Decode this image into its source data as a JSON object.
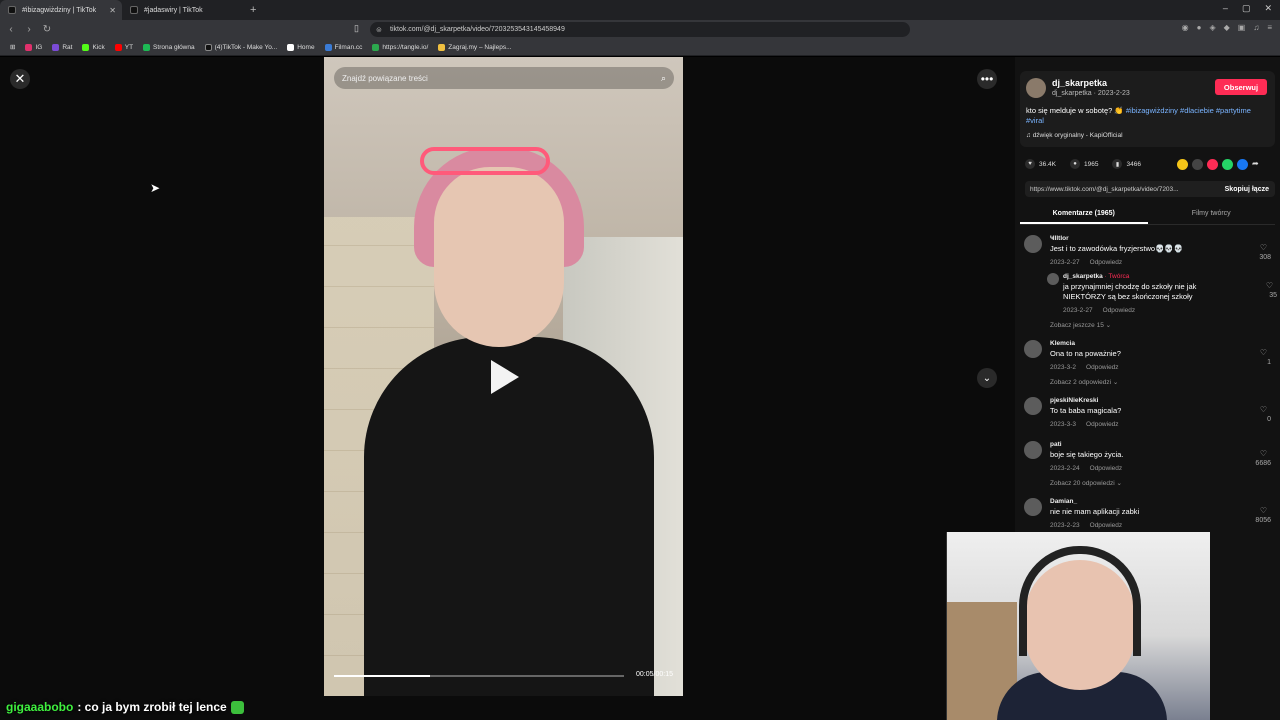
{
  "browser": {
    "tabs": [
      {
        "title": "#ibizagwiżdziny | TikTok",
        "active": true
      },
      {
        "title": "#jadaswiry | TikTok",
        "active": false
      }
    ],
    "url": "tiktok.com/@dj_skarpetka/video/7203253543145458949",
    "bookmarks": [
      "IG",
      "Rat",
      "Kick",
      "YT",
      "Strona główna",
      "(4)TikTok - Make Yo...",
      "Home",
      "Filman.cc",
      "https://tangle.io/",
      "Zagraj.my – Najleps..."
    ]
  },
  "video": {
    "search_placeholder": "Znajdź powiązane treści",
    "time": "00:05/00:15",
    "progress": 0.33
  },
  "post": {
    "username": "dj_skarpetka",
    "sub": "dj_skarpetka · 2023-2-23",
    "follow_label": "Obserwuj",
    "caption_text": "kto się melduje w sobotę? 👏",
    "caption_tags": "#ibizagwiżdziny #dlaciebie #partytime #viral",
    "sound": "dźwięk oryginalny - KapiOfficial",
    "likes": "36.4K",
    "comments": "1965",
    "saves": "3466",
    "link": "https://www.tiktok.com/@dj_skarpetka/video/7203...",
    "copy_label": "Skopiuj łącze",
    "tab_comments": "Komentarze (1965)",
    "tab_creator": "Filmy twórcy"
  },
  "comments": [
    {
      "name": "Ҹlltlor",
      "text": "Jest i to zawodówka fryzjerstwo💀💀💀",
      "date": "2023-2-27",
      "reply": "Odpowiedz",
      "likes": "308"
    },
    {
      "name": "dj_skarpetka",
      "creator_tag": "· Twórca",
      "text": "ja przynajmniej chodzę do szkoły nie jak NIEKTÓRZY są bez skończonej szkoły",
      "date": "2023-2-27",
      "reply": "Odpowiedz",
      "likes": "35",
      "more": "Zobacz jeszcze 15 ⌄"
    },
    {
      "name": "Klemcia",
      "text": "Ona to na poważnie?",
      "date": "2023-3-2",
      "reply": "Odpowiedz",
      "likes": "1",
      "more": "Zobacz 2 odpowiedzi ⌄"
    },
    {
      "name": "pjeskiNieKreski",
      "text": "To ta baba magicala?",
      "date": "2023-3-3",
      "reply": "Odpowiedz",
      "likes": "0"
    },
    {
      "name": "pati",
      "text": "boje się takiego życia.",
      "date": "2023-2-24",
      "reply": "Odpowiedz",
      "likes": "6686",
      "more": "Zobacz 20 odpowiedzi ⌄"
    },
    {
      "name": "Damian_",
      "text": "nie nie mam aplikacji zabki",
      "date": "2023-2-23",
      "reply": "Odpowiedz",
      "likes": "8056"
    }
  ],
  "chat": {
    "user": "gigaaabobo",
    "message": ": co ja bym zrobił tej lence"
  }
}
